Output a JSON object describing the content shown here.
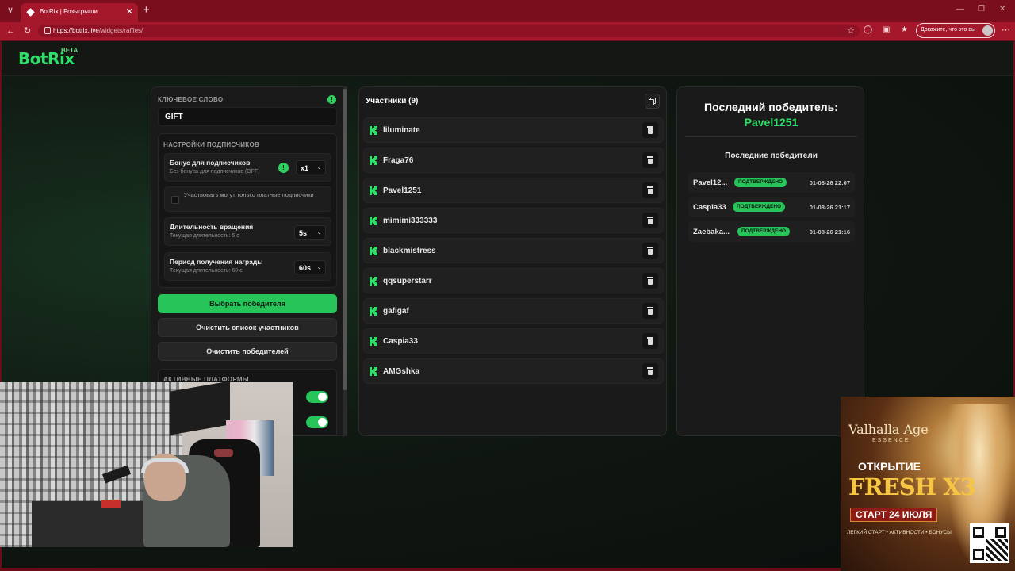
{
  "browser": {
    "tab_title": "BotRix | Розыгрыши",
    "url_host": "https://botrix.live",
    "url_path": "/widgets/raffles/",
    "profile_label": "Докажите, что это вы"
  },
  "header": {
    "logo": "BotRix",
    "badge": "BETA"
  },
  "settings": {
    "keyword_label": "КЛЮЧЕВОЕ СЛОВО",
    "keyword_value": "GIFT",
    "subs_title": "НАСТРОЙКИ ПОДПИСЧИКОВ",
    "bonus_label": "Бонус для подписчиков",
    "bonus_sub": "Без бонуса для подписчиков (OFF)",
    "bonus_value": "x1",
    "paid_only_label": "Участвовать могут только платные подписчики",
    "spin_label": "Длительность вращения",
    "spin_sub": "Текущая длительность: 5 с",
    "spin_value": "5s",
    "reward_label": "Период получения награды",
    "reward_sub": "Текущая длительность: 60 с",
    "reward_value": "60s",
    "pick_winner": "Выбрать победителя",
    "clear_participants": "Очистить список участников",
    "clear_winners": "Очистить победителей",
    "platforms_title": "АКТИВНЫЕ ПЛАТФОРМЫ"
  },
  "participants": {
    "title": "Участники (9)",
    "items": [
      "liluminate",
      "Fraga76",
      "Pavel1251",
      "mimimi333333",
      "blackmistress",
      "qqsuperstarr",
      "gafigaf",
      "Caspia33",
      "AMGshka"
    ]
  },
  "winners": {
    "last_title": "Последний победитель:",
    "last_name": "Pavel1251",
    "recent_title": "Последние победители",
    "rows": [
      {
        "name": "Pavel12...",
        "badge": "ПОДТВЕРЖДЕНО",
        "date": "01-08-26 22:07"
      },
      {
        "name": "Caspia33",
        "badge": "ПОДТВЕРЖДЕНО",
        "date": "01-08-26 21:17"
      },
      {
        "name": "Zaebaka...",
        "badge": "ПОДТВЕРЖДЕНО",
        "date": "01-08-26 21:16"
      }
    ]
  },
  "ad": {
    "brand": "Valhalla Age",
    "essence": "ESSENCE",
    "open": "ОТКРЫТИЕ",
    "fresh": "FRESH X3",
    "start": "СТАРТ 24 ИЮЛЯ",
    "tagline": "ЛЕГКИЙ СТАРТ • АКТИВНОСТИ • БОНУСЫ"
  },
  "colors": {
    "accent": "#27c45a",
    "browser_frame": "#a5172b"
  }
}
